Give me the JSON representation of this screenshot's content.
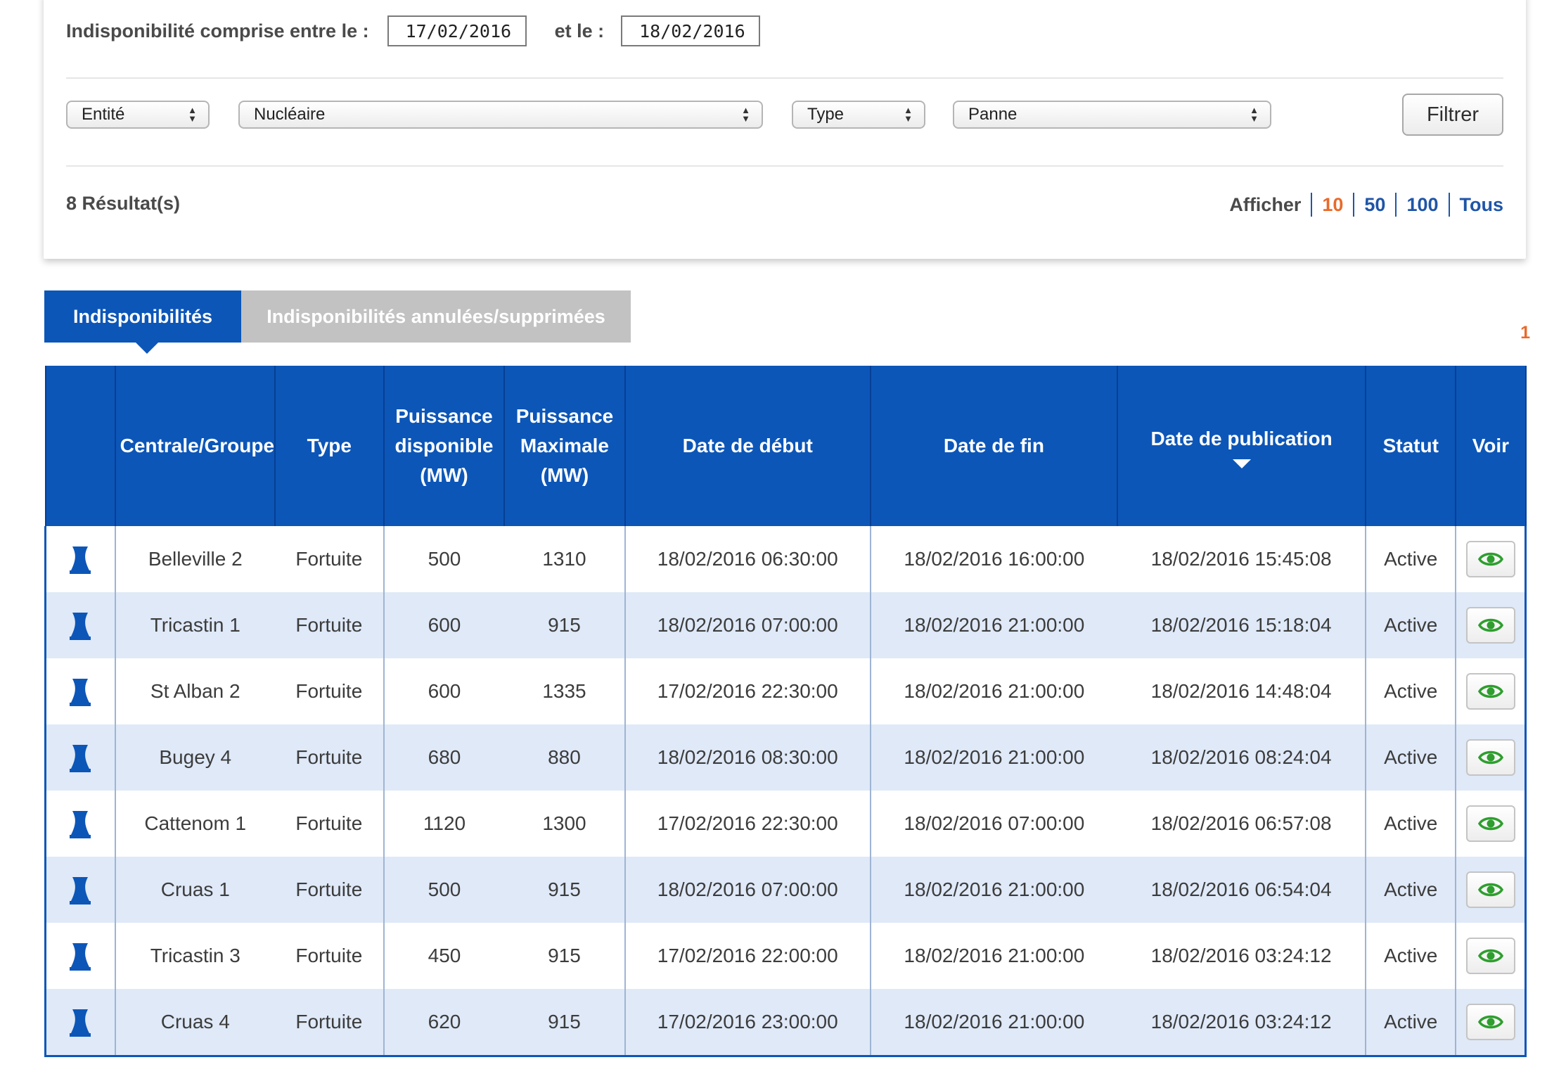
{
  "filters": {
    "date_label": "Indisponibilité comprise entre le :",
    "start_date": "17/02/2016",
    "and_label": "et le :",
    "end_date": "18/02/2016",
    "entity_select": "Entité",
    "entity_value": "Nucléaire",
    "type_select": "Type",
    "type_value": "Panne",
    "filter_button": "Filtrer"
  },
  "results": {
    "count_label": "8 Résultat(s)",
    "show_label": "Afficher",
    "page_sizes": [
      "10",
      "50",
      "100",
      "Tous"
    ],
    "active_page_size": "10"
  },
  "tabs": {
    "active": "Indisponibilités",
    "inactive": "Indisponibilités annulées/supprimées"
  },
  "pagination": {
    "current_page": "1"
  },
  "table": {
    "headers": {
      "plant": "Centrale/Groupe",
      "type": "Type",
      "available_power": [
        "Puissance",
        "disponible",
        "(MW)"
      ],
      "max_power": [
        "Puissance",
        "Maximale",
        "(MW)"
      ],
      "start_date": "Date de début",
      "end_date": "Date de fin",
      "publication_date": "Date de publication",
      "status": "Statut",
      "view": "Voir"
    },
    "rows": [
      {
        "plant": "Belleville 2",
        "type": "Fortuite",
        "available": "500",
        "max": "1310",
        "start": "18/02/2016 06:30:00",
        "end": "18/02/2016 16:00:00",
        "published": "18/02/2016 15:45:08",
        "status": "Active"
      },
      {
        "plant": "Tricastin 1",
        "type": "Fortuite",
        "available": "600",
        "max": "915",
        "start": "18/02/2016 07:00:00",
        "end": "18/02/2016 21:00:00",
        "published": "18/02/2016 15:18:04",
        "status": "Active"
      },
      {
        "plant": "St Alban 2",
        "type": "Fortuite",
        "available": "600",
        "max": "1335",
        "start": "17/02/2016 22:30:00",
        "end": "18/02/2016 21:00:00",
        "published": "18/02/2016 14:48:04",
        "status": "Active"
      },
      {
        "plant": "Bugey 4",
        "type": "Fortuite",
        "available": "680",
        "max": "880",
        "start": "18/02/2016 08:30:00",
        "end": "18/02/2016 21:00:00",
        "published": "18/02/2016 08:24:04",
        "status": "Active"
      },
      {
        "plant": "Cattenom 1",
        "type": "Fortuite",
        "available": "1120",
        "max": "1300",
        "start": "17/02/2016 22:30:00",
        "end": "18/02/2016 07:00:00",
        "published": "18/02/2016 06:57:08",
        "status": "Active"
      },
      {
        "plant": "Cruas 1",
        "type": "Fortuite",
        "available": "500",
        "max": "915",
        "start": "18/02/2016 07:00:00",
        "end": "18/02/2016 21:00:00",
        "published": "18/02/2016 06:54:04",
        "status": "Active"
      },
      {
        "plant": "Tricastin 3",
        "type": "Fortuite",
        "available": "450",
        "max": "915",
        "start": "17/02/2016 22:00:00",
        "end": "18/02/2016 21:00:00",
        "published": "18/02/2016 03:24:12",
        "status": "Active"
      },
      {
        "plant": "Cruas 4",
        "type": "Fortuite",
        "available": "620",
        "max": "915",
        "start": "17/02/2016 23:00:00",
        "end": "18/02/2016 21:00:00",
        "published": "18/02/2016 03:24:12",
        "status": "Active"
      }
    ]
  },
  "icons": {
    "row_icon": "nuclear-plant-icon",
    "view_icon": "eye-icon"
  },
  "colors": {
    "header_blue": "#0c56b8",
    "row_alt": "#dfe9f8",
    "accent_orange": "#e96a2a",
    "link_blue": "#1f55a8",
    "eye_green": "#2e9e2e"
  }
}
